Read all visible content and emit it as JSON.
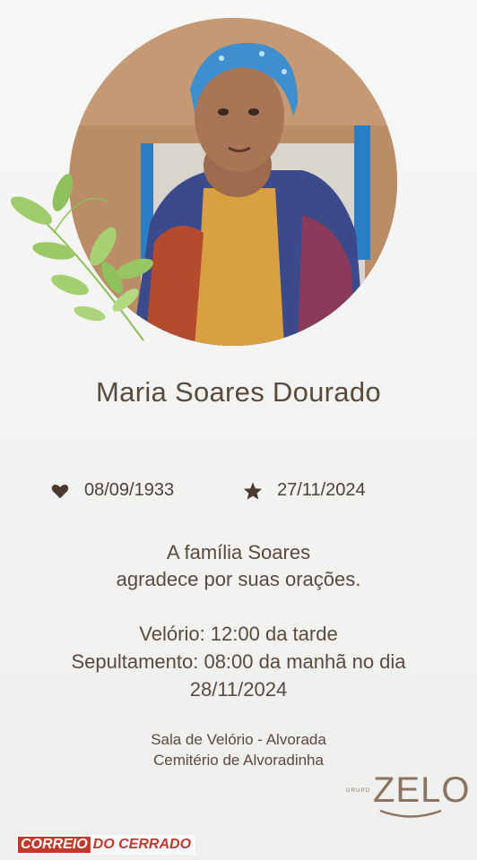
{
  "person": {
    "name": "Maria Soares Dourado",
    "birth_date": "08/09/1933",
    "death_date": "27/11/2024",
    "birth_icon": "heart-icon",
    "death_icon": "star-icon"
  },
  "message": {
    "line1": "A família Soares",
    "line2": "agradece por suas orações."
  },
  "ceremony": {
    "wake": "Velório: 12:00 da tarde",
    "burial_line1": "Sepultamento: 08:00 da manhã no dia",
    "burial_line2": "28/11/2024"
  },
  "location": {
    "hall": "Sala de Velório - Alvorada",
    "cemetery": "Cemitério de Alvoradinha"
  },
  "branding": {
    "zelo_small": "GRUPO",
    "zelo_word": "ZELO",
    "watermark_part1": "CORREIO",
    "watermark_part2": "DO CERRADO"
  },
  "colors": {
    "text": "#5a4a3e",
    "accent_brown": "#8a7462",
    "leaf_green": "#8cbf5a",
    "watermark_red": "#c0392b"
  }
}
